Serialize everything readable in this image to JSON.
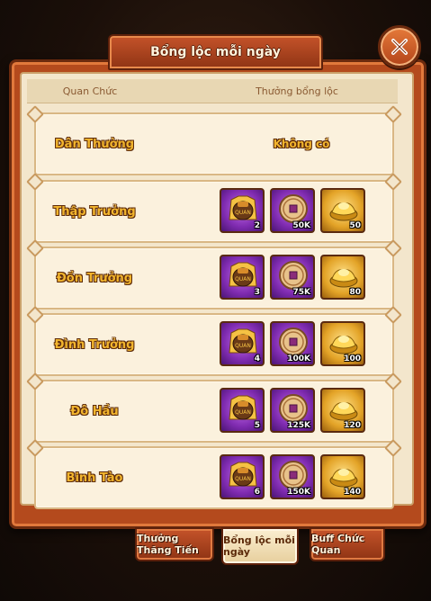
{
  "title": "Bổng lộc mỗi ngày",
  "columns": {
    "rank": "Quan Chức",
    "reward": "Thưởng bổng lộc"
  },
  "rows": [
    {
      "rank": "Dân Thường",
      "no_reward": "Không có",
      "items": []
    },
    {
      "rank": "Thập Trưởng",
      "items": [
        {
          "icon": "treasure-bag-icon",
          "color": "purple",
          "qty": "2"
        },
        {
          "icon": "coin-icon",
          "color": "purple",
          "qty": "50K"
        },
        {
          "icon": "gold-ingot-icon",
          "color": "gold",
          "qty": "50"
        }
      ]
    },
    {
      "rank": "Đồn Trưởng",
      "items": [
        {
          "icon": "treasure-bag-icon",
          "color": "purple",
          "qty": "3"
        },
        {
          "icon": "coin-icon",
          "color": "purple",
          "qty": "75K"
        },
        {
          "icon": "gold-ingot-icon",
          "color": "gold",
          "qty": "80"
        }
      ]
    },
    {
      "rank": "Đình Trưởng",
      "items": [
        {
          "icon": "treasure-bag-icon",
          "color": "purple",
          "qty": "4"
        },
        {
          "icon": "coin-icon",
          "color": "purple",
          "qty": "100K"
        },
        {
          "icon": "gold-ingot-icon",
          "color": "gold",
          "qty": "100"
        }
      ]
    },
    {
      "rank": "Đô Hầu",
      "items": [
        {
          "icon": "treasure-bag-icon",
          "color": "purple",
          "qty": "5"
        },
        {
          "icon": "coin-icon",
          "color": "purple",
          "qty": "125K"
        },
        {
          "icon": "gold-ingot-icon",
          "color": "gold",
          "qty": "120"
        }
      ]
    },
    {
      "rank": "Binh Tào",
      "items": [
        {
          "icon": "treasure-bag-icon",
          "color": "purple",
          "qty": "6"
        },
        {
          "icon": "coin-icon",
          "color": "purple",
          "qty": "150K"
        },
        {
          "icon": "gold-ingot-icon",
          "color": "gold",
          "qty": "140"
        }
      ]
    }
  ],
  "tabs": [
    {
      "label": "Thưởng Thăng Tiến",
      "active": false
    },
    {
      "label": "Bổng lộc mỗi ngày",
      "active": true
    },
    {
      "label": "Buff Chức Quan",
      "active": false
    }
  ],
  "colors": {
    "accent": "#b44a1d",
    "rank_text": "#f2b52e",
    "panel_bg": "#f3e6cc"
  }
}
